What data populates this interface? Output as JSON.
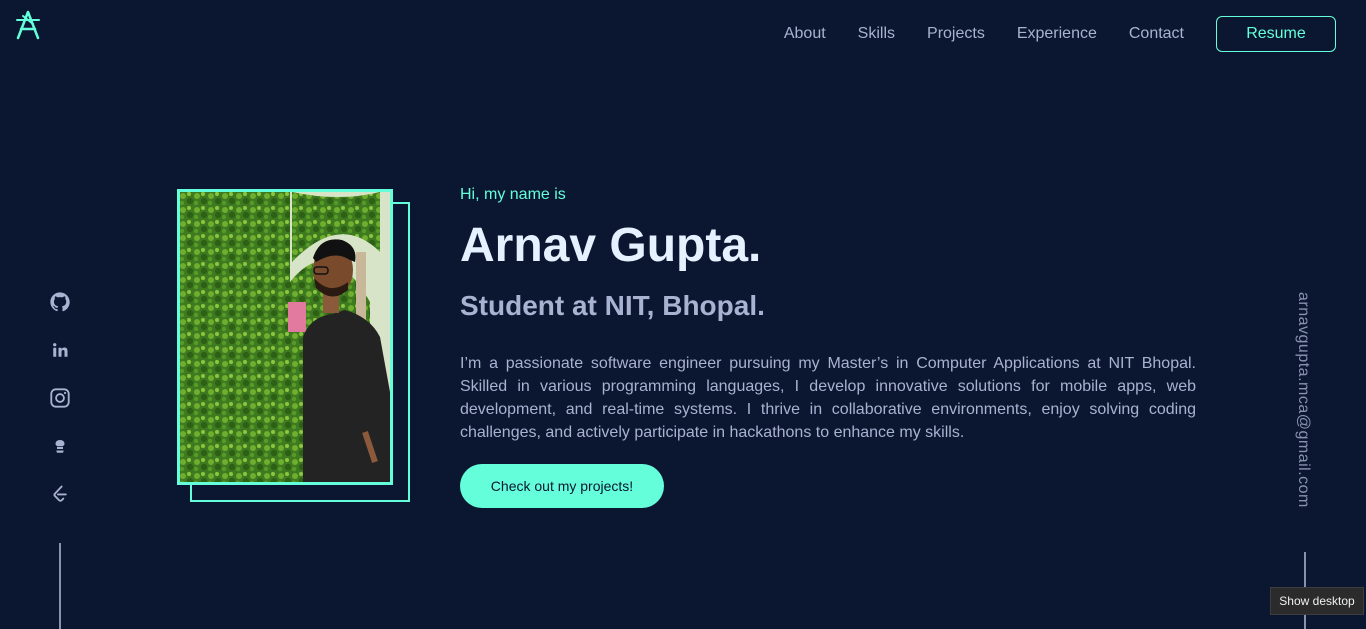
{
  "header": {
    "logo_icon": "stylized-A-logo",
    "nav": [
      {
        "label": "About"
      },
      {
        "label": "Skills"
      },
      {
        "label": "Projects"
      },
      {
        "label": "Experience"
      },
      {
        "label": "Contact"
      }
    ],
    "resume_label": "Resume"
  },
  "social": {
    "icons": [
      "github-icon",
      "linkedin-icon",
      "instagram-icon",
      "codechef-icon",
      "leetcode-icon"
    ]
  },
  "hero": {
    "greeting": "Hi, my name is",
    "name": "Arnav Gupta.",
    "tagline": "Student at NIT, Bhopal.",
    "bio": "I’m a passionate software engineer pursuing my Master’s in Computer Applications at NIT Bhopal. Skilled in various programming languages, I develop innovative solutions for mobile apps, web development, and real-time systems. I thrive in collaborative environments, enjoy solving coding challenges, and actively participate in hackathons to enhance my skills.",
    "cta_label": "Check out my projects!"
  },
  "email": "arnavgupta.mca@gmail.com",
  "tooltip": "Show desktop",
  "colors": {
    "background": "#0b1730",
    "accent": "#64ffda",
    "heading": "#e6f1ff",
    "text": "#a8b2d1"
  }
}
